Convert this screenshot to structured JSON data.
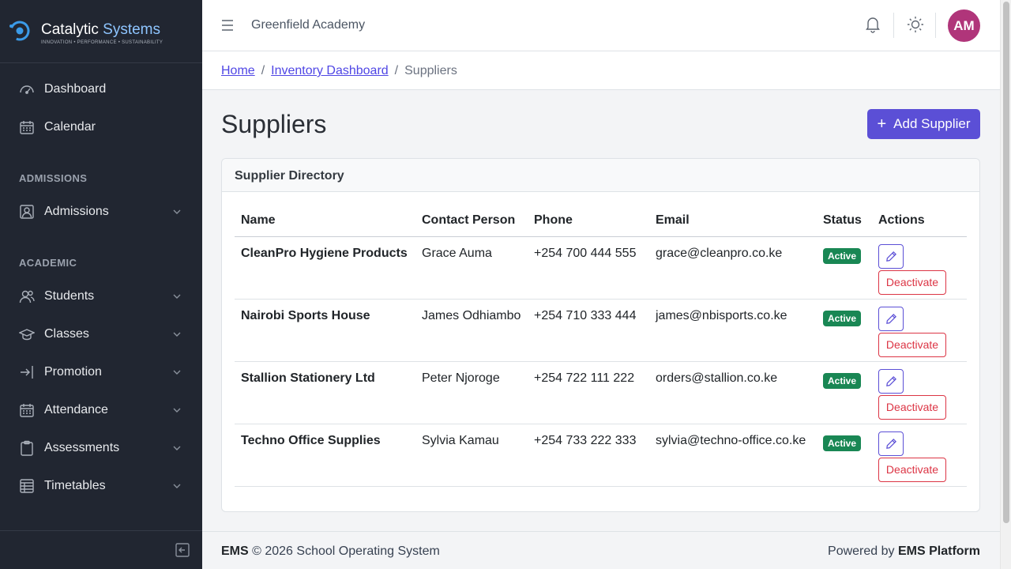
{
  "brand": {
    "name_part1": "Catalytic",
    "name_part2": "Systems",
    "tagline": "INNOVATION • PERFORMANCE • SUSTAINABILITY",
    "accent_color": "#8ec5ff"
  },
  "sidebar": {
    "items": [
      {
        "label": "Dashboard",
        "icon": "speedometer-icon"
      },
      {
        "label": "Calendar",
        "icon": "calendar-icon"
      }
    ],
    "sections": [
      {
        "title": "ADMISSIONS",
        "items": [
          {
            "label": "Admissions",
            "icon": "person-badge-icon"
          }
        ]
      },
      {
        "title": "ACADEMIC",
        "items": [
          {
            "label": "Students",
            "icon": "people-icon"
          },
          {
            "label": "Classes",
            "icon": "mortarboard-icon"
          },
          {
            "label": "Promotion",
            "icon": "box-arrow-right-icon"
          },
          {
            "label": "Attendance",
            "icon": "calendar-check-icon"
          },
          {
            "label": "Assessments",
            "icon": "clipboard-icon"
          },
          {
            "label": "Timetables",
            "icon": "table-icon"
          }
        ]
      }
    ]
  },
  "header": {
    "org_name": "Greenfield Academy",
    "avatar_initials": "AM",
    "avatar_color": "#b0357a"
  },
  "breadcrumb": {
    "home": "Home",
    "inventory": "Inventory Dashboard",
    "current": "Suppliers",
    "separator": "/"
  },
  "main": {
    "title": "Suppliers",
    "add_button": "Add Supplier",
    "card_title": "Supplier Directory"
  },
  "table": {
    "columns": {
      "name": "Name",
      "contact": "Contact Person",
      "phone": "Phone",
      "email": "Email",
      "status": "Status",
      "actions": "Actions"
    },
    "deactivate_label": "Deactivate",
    "rows": [
      {
        "name": "CleanPro Hygiene Products",
        "contact": "Grace Auma",
        "phone": "+254 700 444 555",
        "email": "grace@cleanpro.co.ke",
        "status": "Active"
      },
      {
        "name": "Nairobi Sports House",
        "contact": "James Odhiambo",
        "phone": "+254 710 333 444",
        "email": "james@nbisports.co.ke",
        "status": "Active"
      },
      {
        "name": "Stallion Stationery Ltd",
        "contact": "Peter Njoroge",
        "phone": "+254 722 111 222",
        "email": "orders@stallion.co.ke",
        "status": "Active"
      },
      {
        "name": "Techno Office Supplies",
        "contact": "Sylvia Kamau",
        "phone": "+254 733 222 333",
        "email": "sylvia@techno-office.co.ke",
        "status": "Active"
      }
    ]
  },
  "footer": {
    "left_bold": "EMS",
    "left_text": "© 2026 School Operating System",
    "right_text": "Powered by",
    "right_bold": "EMS Platform"
  }
}
